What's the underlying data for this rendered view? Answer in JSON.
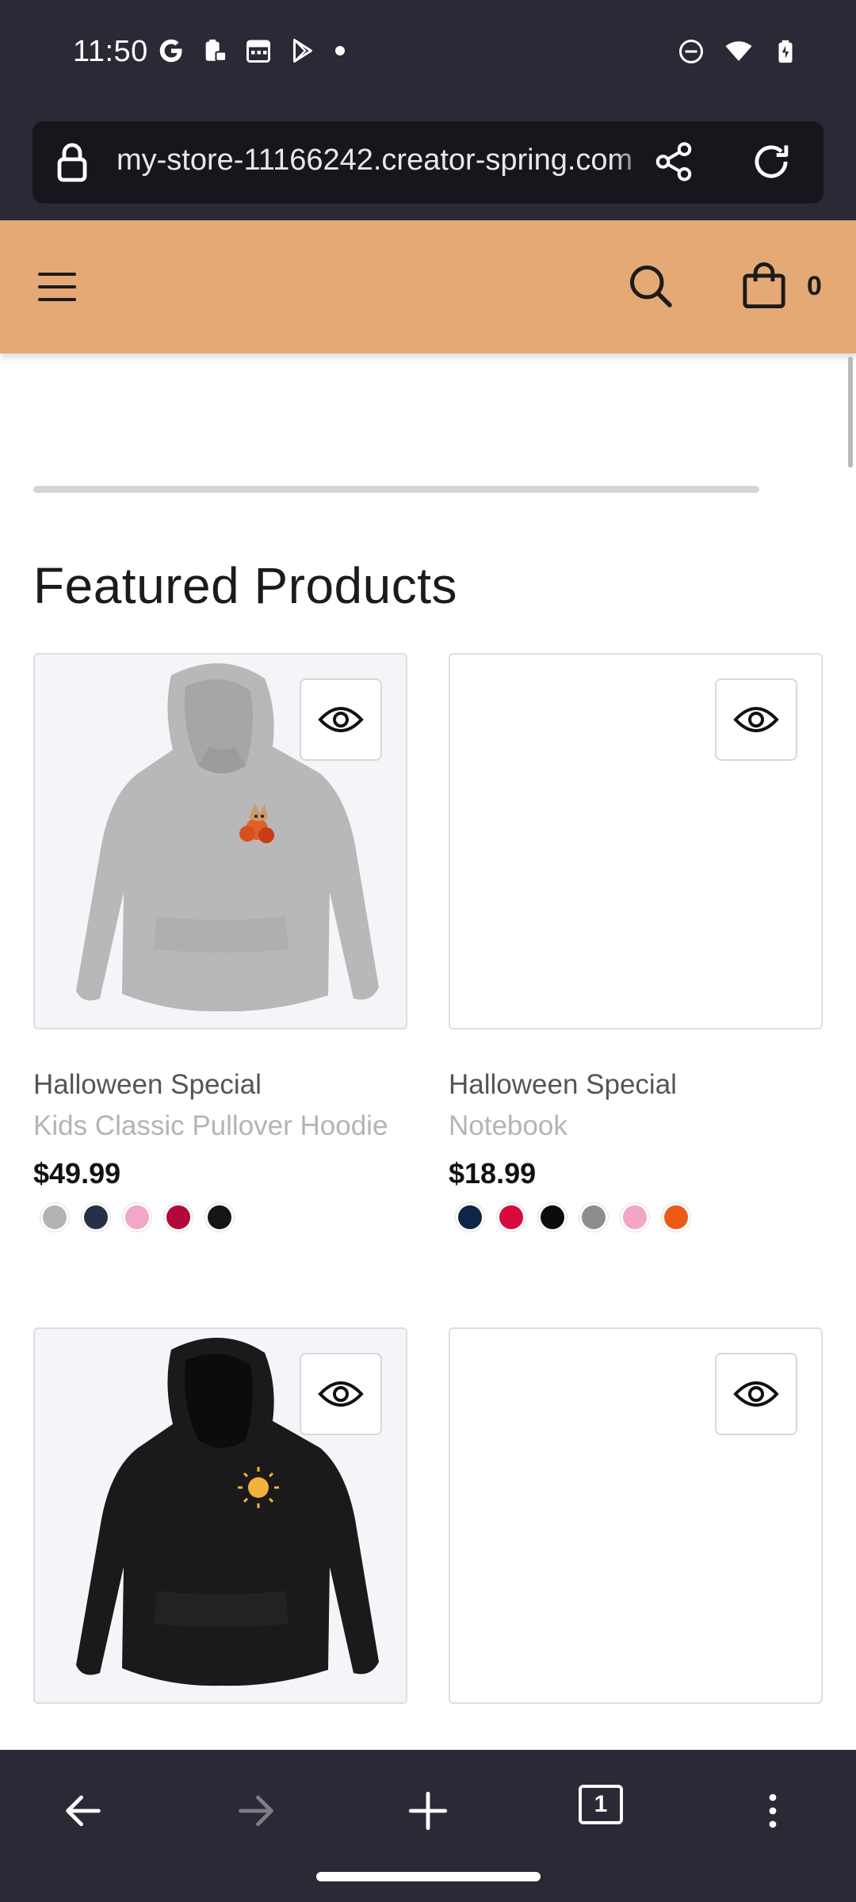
{
  "status_bar": {
    "time": "11:50",
    "left_icons": [
      "google-icon",
      "clipboard-lock-icon",
      "calendar-icon",
      "play-store-icon",
      "dot-icon"
    ],
    "right_icons": [
      "do-not-disturb-icon",
      "wifi-icon",
      "battery-icon"
    ]
  },
  "browser": {
    "url": "my-store-11166242.creator-spring.com",
    "icons": [
      "lock-icon",
      "share-icon",
      "reload-icon"
    ]
  },
  "site_header": {
    "background_color": "#e4a974",
    "cart_count": "0",
    "icons": [
      "hamburger-menu-icon",
      "search-icon",
      "shopping-bag-icon"
    ]
  },
  "featured": {
    "title": "Featured Products",
    "products": [
      {
        "title": "Halloween Special",
        "subtitle": "Kids Classic Pullover Hoodie",
        "price": "$49.99",
        "image": "grey-hoodie",
        "swatches": [
          "#b3b3b3",
          "#283048",
          "#f2a7c8",
          "#b4073a",
          "#161616"
        ]
      },
      {
        "title": "Halloween Special",
        "subtitle": "Notebook",
        "price": "$18.99",
        "image": "blank",
        "swatches": [
          "#0f2548",
          "#d80b3c",
          "#0b0b0b",
          "#8d8d8d",
          "#f3a5c6",
          "#ec5b14"
        ]
      },
      {
        "title": "",
        "subtitle": "",
        "price": "",
        "image": "black-hoodie",
        "swatches": []
      },
      {
        "title": "",
        "subtitle": "",
        "price": "",
        "image": "blank",
        "swatches": []
      }
    ]
  },
  "bottom_nav": {
    "tab_count": "1",
    "icons": [
      "back-arrow-icon",
      "forward-arrow-icon",
      "new-tab-plus-icon",
      "tab-switcher-icon",
      "more-options-icon"
    ]
  }
}
